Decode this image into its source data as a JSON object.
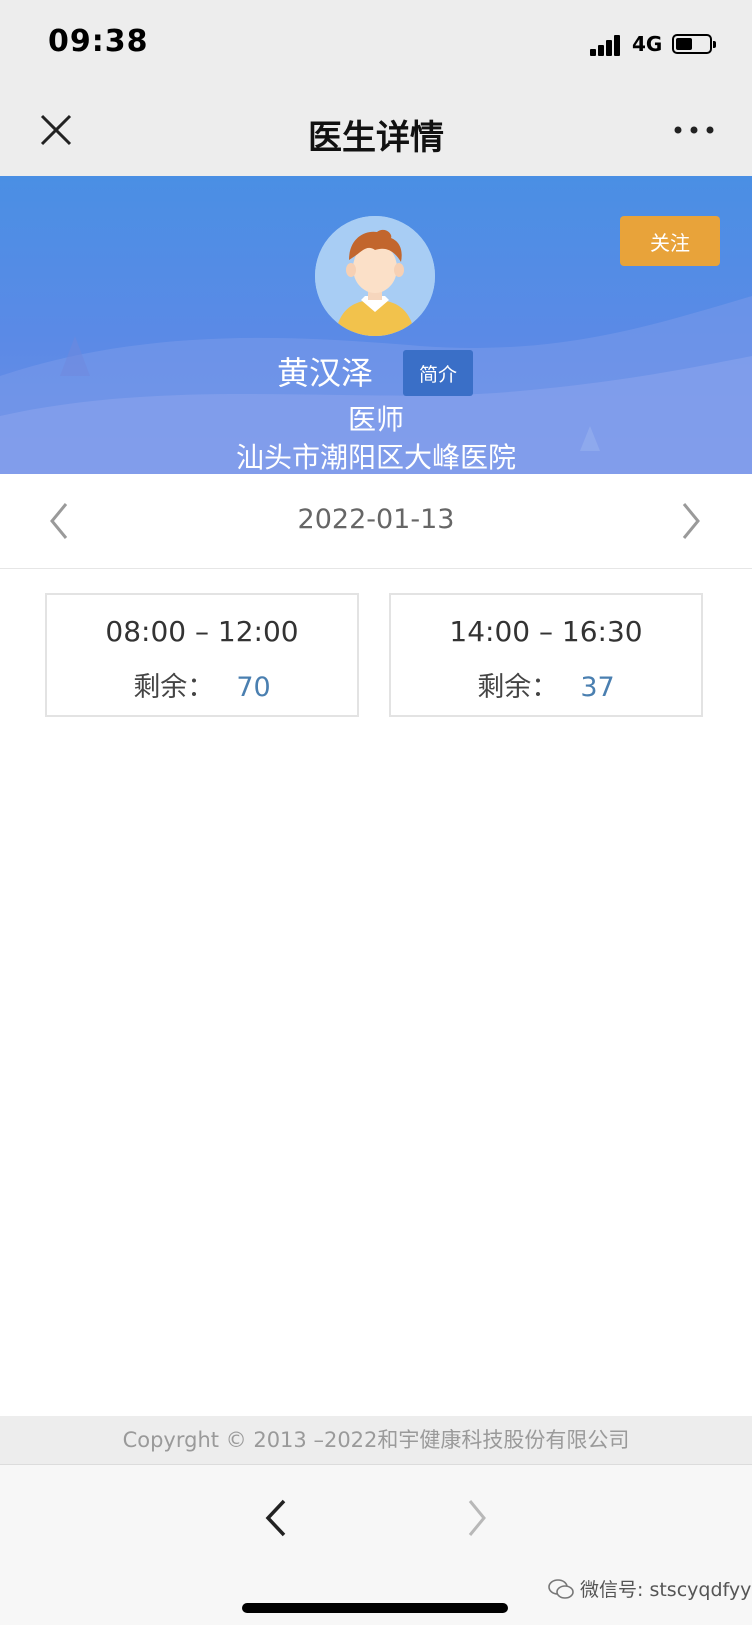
{
  "status_bar": {
    "time": "09:38",
    "network": "4G"
  },
  "nav": {
    "title": "医生详情"
  },
  "doctor": {
    "name": "黄汉泽",
    "title": "医师",
    "hospital": "汕头市潮阳区大峰医院",
    "follow_label": "关注",
    "intro_label": "简介"
  },
  "schedule": {
    "date": "2022-01-13",
    "slots": [
      {
        "range": "08:00 – 12:00",
        "remain_label": "剩余：",
        "remain": "70"
      },
      {
        "range": "14:00 – 16:30",
        "remain_label": "剩余：",
        "remain": "37"
      }
    ]
  },
  "footer": {
    "copyright": "Copyrght © 2013 –2022和宇健康科技股份有限公司",
    "watermark": "微信号: stscyqdfyy"
  },
  "colors": {
    "hero": "#4a8fe4",
    "follow": "#e8a33a",
    "intro": "#3a6fc7",
    "remain_number": "#4a7fb0"
  }
}
